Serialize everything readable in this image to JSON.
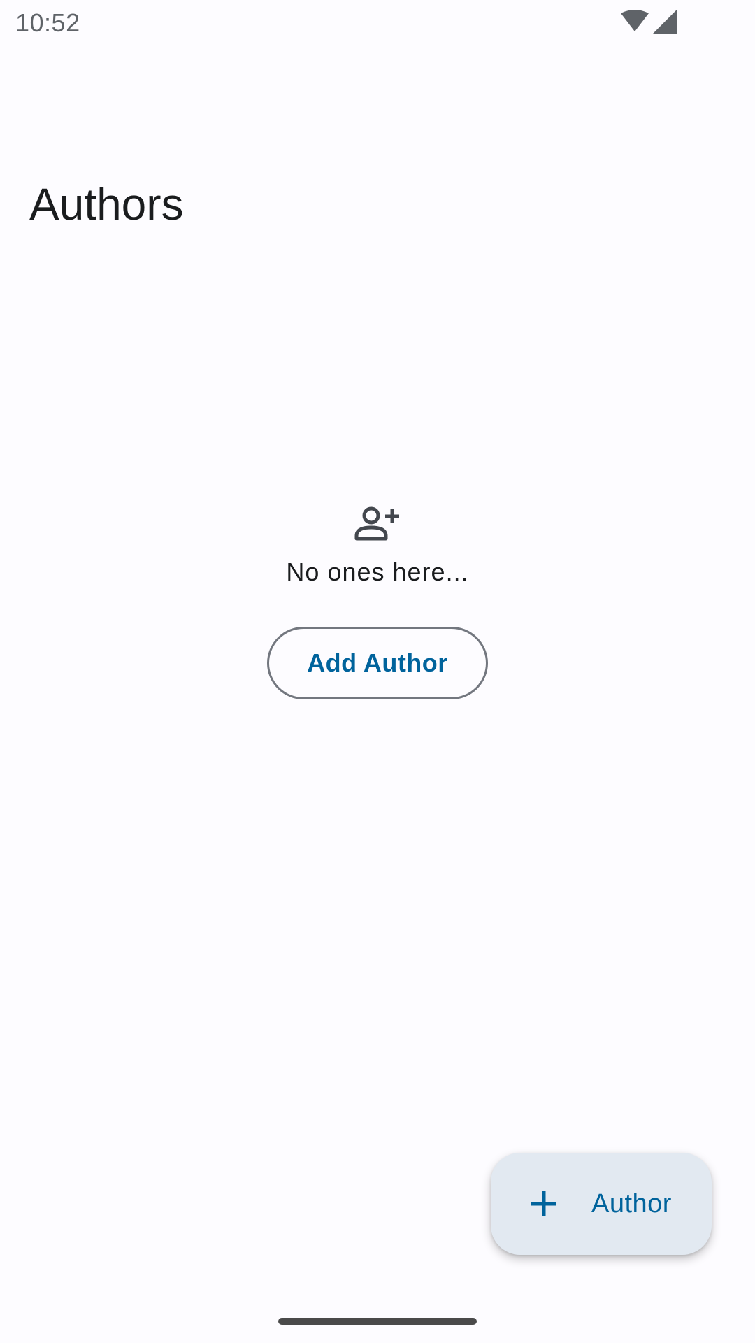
{
  "status_bar": {
    "time": "10:52",
    "icons": [
      "wifi-icon",
      "cellular-signal-icon"
    ]
  },
  "page": {
    "title": "Authors"
  },
  "empty_state": {
    "icon": "person-add-icon",
    "message": "No ones here...",
    "button_label": "Add Author"
  },
  "fab": {
    "icon": "plus-icon",
    "label": "Author"
  },
  "colors": {
    "background": "#fdfcff",
    "primary": "#00639c",
    "outline": "#73777f",
    "fab_container": "#e2e9f1",
    "on_surface": "#1a1c1e"
  }
}
